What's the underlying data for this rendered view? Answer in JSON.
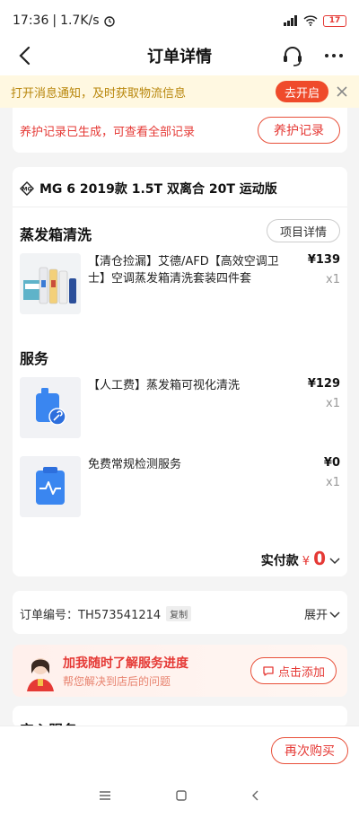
{
  "status": {
    "time": "17:36",
    "speed": "1.7K/s",
    "battery": "17"
  },
  "nav": {
    "title": "订单详情"
  },
  "notice": {
    "text": "打开消息通知，及时获取物流信息",
    "button": "去开启"
  },
  "maintenance": {
    "text": "养护记录已生成，可查看全部记录",
    "button": "养护记录"
  },
  "car": {
    "name": "MG 6 2019款 1.5T 双离合 20T 运动版"
  },
  "sections": {
    "evap_title": "蒸发箱清洗",
    "evap_detail_button": "项目详情",
    "service_title": "服务"
  },
  "items": [
    {
      "name": "【清仓捡漏】艾德/AFD【高效空调卫士】空调蒸发箱清洗套装四件套",
      "price": "¥139",
      "qty": "x1"
    },
    {
      "name": "【人工费】蒸发箱可视化清洗",
      "price": "¥129",
      "qty": "x1"
    },
    {
      "name": "免费常规检测服务",
      "price": "¥0",
      "qty": "x1"
    }
  ],
  "total": {
    "label": "实付款",
    "currency": "¥",
    "value": "0"
  },
  "order": {
    "label": "订单编号：TH573541214",
    "copy": "复制",
    "expand": "展开"
  },
  "add_service": {
    "title": "加我随时了解服务进度",
    "subtitle": "帮您解决到店后的问题",
    "button": "点击添加"
  },
  "peek_section": {
    "title": "安心服务"
  },
  "bottom": {
    "rebuy": "再次购买"
  },
  "colors": {
    "accent": "#e53935",
    "notice_bg": "#fff8e1",
    "notice_text": "#b8860b"
  }
}
